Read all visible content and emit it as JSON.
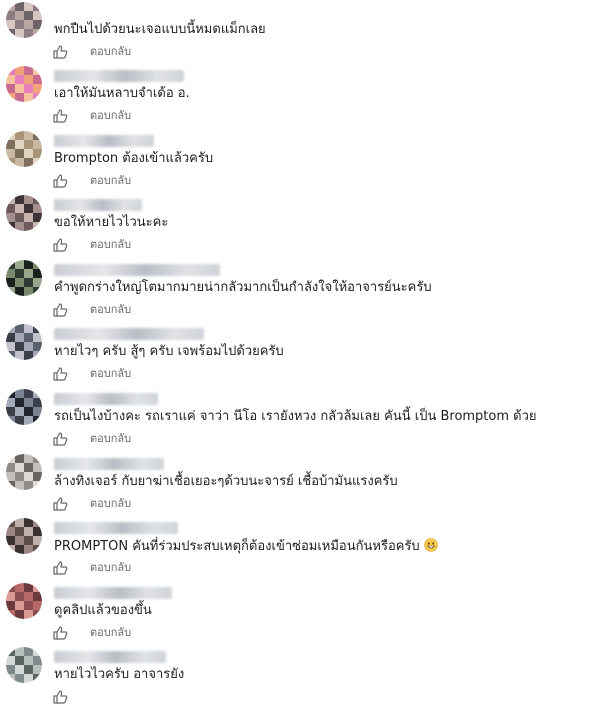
{
  "reply_label": "ตอบกลับ",
  "comments": [
    {
      "text": "พกปืนไปด้วยนะเจอแบบนี้หมดแม็กเลย",
      "avatar": [
        "#b9a7a4",
        "#8b7d80",
        "#d6c6c2",
        "#6e6468"
      ]
    },
    {
      "text": "เอาให้มันหลาบจำเด้อ อ.",
      "avatar": [
        "#f0a37a",
        "#e87fb8",
        "#f6c2a0",
        "#c86b8e"
      ]
    },
    {
      "text": "Brompton ต้องเข้าแล้วครับ",
      "avatar": [
        "#c9b9a2",
        "#a89479",
        "#e0d3c0",
        "#7d6d5c"
      ]
    },
    {
      "text": "ขอให้หายไวไวนะคะ",
      "avatar": [
        "#6d5a5a",
        "#a38f8c",
        "#3e3436",
        "#c8b5ae"
      ]
    },
    {
      "text": "คำพูดกร่างใหญ่โตมากมายน่ากลัวมากเป็นกำลังใจให้อาจารย์นะครับ",
      "avatar": [
        "#2f3a33",
        "#7a8a6c",
        "#1a201c",
        "#9aa68c"
      ]
    },
    {
      "text": "หายไวๆ ครับ สู้ๆ ครับ เจพร้อมไปด้วยครับ",
      "avatar": [
        "#5a6070",
        "#a5a8b4",
        "#3b3f4a",
        "#c2c3cc"
      ]
    },
    {
      "text": "รถเป็นไงบ้างคะ รถเราแค่ จาว่า นีโอ เรายังหวง กลัวล้มเลย คันนี้ เป็น Bromptom ด้วย",
      "avatar": [
        "#3a3f4a",
        "#7b8294",
        "#22252c",
        "#a5aab8"
      ]
    },
    {
      "text": "ล้างทิงเจอร์ กับยาฆ่าเชื้อเยอะๆด้วบนะจารย์ เชื้อบ้ามันแรงครับ",
      "avatar": [
        "#8f8a86",
        "#c4bfbb",
        "#6a6562",
        "#dedad6"
      ]
    },
    {
      "text": "PROMPTON คันที่ร่วมประสบเหตุก็ต้องเข้าซ่อมเหมือนกันหรือครับ",
      "avatar": [
        "#5c4d4b",
        "#9a8783",
        "#3a302f",
        "#c0b0ab"
      ]
    },
    {
      "text": "ดูคลิปแล้วของขึ้น",
      "avatar": [
        "#b86a6a",
        "#8a4e52",
        "#d89a94",
        "#6a3a3e"
      ]
    },
    {
      "text": "หายไวไวครับ อาจารยัง",
      "avatar": [
        "#7f8a8a",
        "#b6bebe",
        "#5a6262",
        "#d2d8d8"
      ]
    }
  ]
}
